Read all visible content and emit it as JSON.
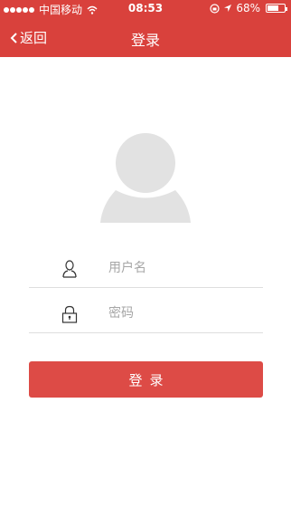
{
  "status_bar": {
    "carrier": "中国移动",
    "time": "08:53",
    "battery": "68%",
    "battery_level": 0.68,
    "icons": [
      "signal-dots-icon",
      "wifi-icon",
      "lock-rotation-icon",
      "location-arrow-icon",
      "battery-icon"
    ]
  },
  "nav": {
    "back_label": "返回",
    "title": "登录"
  },
  "form": {
    "username_placeholder": "用户名",
    "password_placeholder": "密码",
    "username_icon": "user-icon",
    "password_icon": "lock-icon"
  },
  "login_button_label": "登录",
  "colors": {
    "header": "#d9413c",
    "button": "#dd4b46",
    "avatar": "#e2e2e2",
    "divider": "#dedede"
  }
}
